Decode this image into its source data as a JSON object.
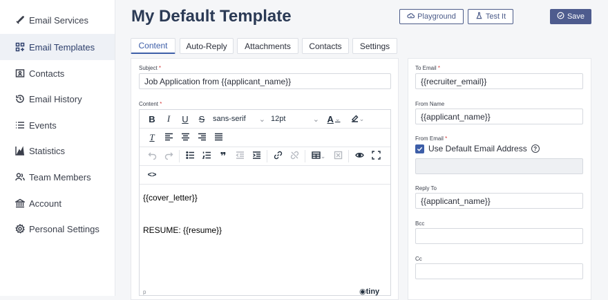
{
  "sidebar": {
    "items": [
      {
        "label": "Email Services",
        "icon": "rocket-icon",
        "active": false
      },
      {
        "label": "Email Templates",
        "icon": "template-icon",
        "active": true
      },
      {
        "label": "Contacts",
        "icon": "contact-card-icon",
        "active": false
      },
      {
        "label": "Email History",
        "icon": "history-icon",
        "active": false
      },
      {
        "label": "Events",
        "icon": "list-icon",
        "active": false
      },
      {
        "label": "Statistics",
        "icon": "bar-chart-icon",
        "active": false
      },
      {
        "label": "Team Members",
        "icon": "team-icon",
        "active": false
      },
      {
        "label": "Account",
        "icon": "bank-icon",
        "active": false
      },
      {
        "label": "Personal Settings",
        "icon": "gear-icon",
        "active": false
      }
    ]
  },
  "header": {
    "title": "My Default Template",
    "playground_label": "Playground",
    "test_label": "Test It",
    "save_label": "Save"
  },
  "tabs": [
    {
      "label": "Content",
      "active": true
    },
    {
      "label": "Auto-Reply",
      "active": false
    },
    {
      "label": "Attachments",
      "active": false
    },
    {
      "label": "Contacts",
      "active": false
    },
    {
      "label": "Settings",
      "active": false
    }
  ],
  "content_form": {
    "subject_label": "Subject",
    "subject_value": "Job Application from {{applicant_name}}",
    "content_label": "Content",
    "toolbar": {
      "font_family": "sans-serif",
      "font_size": "12pt"
    },
    "body_lines": [
      "{{cover_letter}}",
      "RESUME: {{resume}}"
    ],
    "footer_left": "p",
    "footer_brand": "tiny"
  },
  "side_form": {
    "to_email_label": "To Email",
    "to_email_value": "{{recruiter_email}}",
    "from_name_label": "From Name",
    "from_name_value": "{{applicant_name}}",
    "from_email_label": "From Email",
    "use_default_label": "Use Default Email Address",
    "use_default_checked": true,
    "from_email_value": "",
    "reply_to_label": "Reply To",
    "reply_to_value": "{{applicant_name}}",
    "bcc_label": "Bcc",
    "bcc_value": "",
    "cc_label": "Cc",
    "cc_value": ""
  },
  "colors": {
    "accent": "#3d5ea8",
    "primary_button": "#4e5c8e",
    "required": "#d63a3a"
  }
}
